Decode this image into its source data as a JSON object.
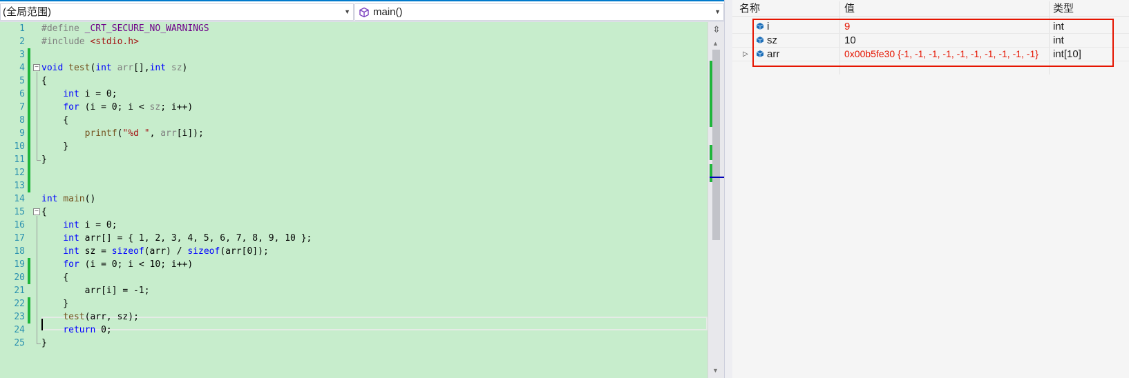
{
  "navigation": {
    "scope": "(全局范围)",
    "function": "main()"
  },
  "code_lines": [
    {
      "num": "1",
      "text": "#define _CRT_SECURE_NO_WARNINGS"
    },
    {
      "num": "2",
      "text": "#include <stdio.h>"
    },
    {
      "num": "3",
      "text": ""
    },
    {
      "num": "4",
      "text": "void test(int arr[],int sz)"
    },
    {
      "num": "5",
      "text": "{"
    },
    {
      "num": "6",
      "text": "    int i = 0;"
    },
    {
      "num": "7",
      "text": "    for (i = 0; i < sz; i++)"
    },
    {
      "num": "8",
      "text": "    {"
    },
    {
      "num": "9",
      "text": "        printf(\"%d \", arr[i]);"
    },
    {
      "num": "10",
      "text": "    }"
    },
    {
      "num": "11",
      "text": "}"
    },
    {
      "num": "12",
      "text": ""
    },
    {
      "num": "13",
      "text": ""
    },
    {
      "num": "14",
      "text": "int main()"
    },
    {
      "num": "15",
      "text": "{"
    },
    {
      "num": "16",
      "text": "    int i = 0;"
    },
    {
      "num": "17",
      "text": "    int arr[] = { 1, 2, 3, 4, 5, 6, 7, 8, 9, 10 };"
    },
    {
      "num": "18",
      "text": "    int sz = sizeof(arr) / sizeof(arr[0]);"
    },
    {
      "num": "19",
      "text": "    for (i = 0; i < 10; i++)"
    },
    {
      "num": "20",
      "text": "    {"
    },
    {
      "num": "21",
      "text": "        arr[i] = -1;"
    },
    {
      "num": "22",
      "text": "    }"
    },
    {
      "num": "23",
      "text": "    test(arr, sz);"
    },
    {
      "num": "24",
      "text": "    return 0;"
    },
    {
      "num": "25",
      "text": "}"
    }
  ],
  "watch": {
    "headers": {
      "name": "名称",
      "value": "值",
      "type": "类型"
    },
    "rows": [
      {
        "name": "i",
        "value": "9",
        "type": "int",
        "expandable": false
      },
      {
        "name": "sz",
        "value": "10",
        "type": "int",
        "expandable": false
      },
      {
        "name": "arr",
        "value": "0x00b5fe30 {-1, -1, -1, -1, -1, -1, -1, -1, -1, -1}",
        "type": "int[10]",
        "expandable": true
      }
    ]
  },
  "icons": {
    "function": "function-cube-icon",
    "variable": "variable-cube-icon",
    "split": "split-editor-icon"
  },
  "colors": {
    "editor_background": "#c7edcc",
    "change_marker": "#1fb53b",
    "keyword": "#0000ff",
    "changed_value": "#e51400",
    "line_number": "#2b91af"
  }
}
